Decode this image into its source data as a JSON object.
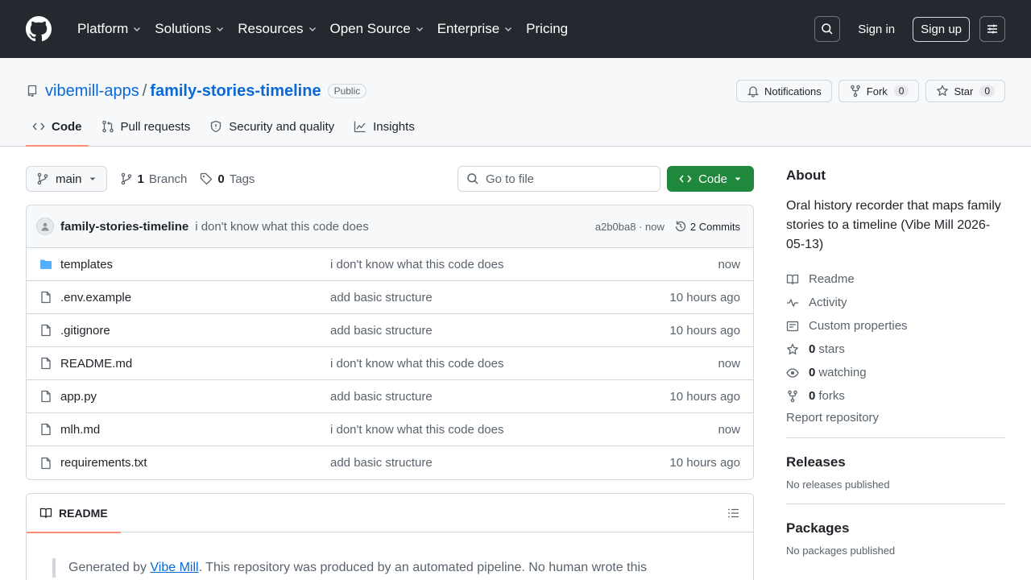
{
  "header": {
    "nav": [
      "Platform",
      "Solutions",
      "Resources",
      "Open Source",
      "Enterprise",
      "Pricing"
    ],
    "sign_in": "Sign in",
    "sign_up": "Sign up"
  },
  "repo": {
    "owner": "vibemill-apps",
    "separator": "/",
    "name": "family-stories-timeline",
    "visibility": "Public",
    "notifications": "Notifications",
    "fork_label": "Fork",
    "fork_count": "0",
    "star_label": "Star",
    "star_count": "0"
  },
  "tabs": [
    {
      "label": "Code",
      "icon": "code-icon"
    },
    {
      "label": "Pull requests",
      "icon": "pull-request-icon"
    },
    {
      "label": "Security and quality",
      "icon": "shield-icon"
    },
    {
      "label": "Insights",
      "icon": "graph-icon"
    }
  ],
  "toolbar": {
    "branch": "main",
    "branch_count": "1",
    "branch_label": "Branch",
    "tag_count": "0",
    "tag_label": "Tags",
    "goto_placeholder": "Go to file",
    "code_button": "Code"
  },
  "commit": {
    "author": "family-stories-timeline",
    "message": "i don't know what this code does",
    "hash_time": "a2b0ba8 · now",
    "commits": "2 Commits"
  },
  "files": [
    {
      "name": "templates",
      "type": "folder",
      "commit": "i don't know what this code does",
      "age": "now"
    },
    {
      "name": ".env.example",
      "type": "file",
      "commit": "add basic structure",
      "age": "10 hours ago"
    },
    {
      "name": ".gitignore",
      "type": "file",
      "commit": "add basic structure",
      "age": "10 hours ago"
    },
    {
      "name": "README.md",
      "type": "file",
      "commit": "i don't know what this code does",
      "age": "now"
    },
    {
      "name": "app.py",
      "type": "file",
      "commit": "add basic structure",
      "age": "10 hours ago"
    },
    {
      "name": "mlh.md",
      "type": "file",
      "commit": "i don't know what this code does",
      "age": "now"
    },
    {
      "name": "requirements.txt",
      "type": "file",
      "commit": "add basic structure",
      "age": "10 hours ago"
    }
  ],
  "readme": {
    "tab": "README",
    "prefix": "Generated by ",
    "link": "Vibe Mill",
    "suffix": ". This repository was produced by an automated pipeline. No human wrote this"
  },
  "about": {
    "title": "About",
    "description": "Oral history recorder that maps family stories to a timeline (Vibe Mill 2026-05-13)",
    "readme": "Readme",
    "activity": "Activity",
    "custom_properties": "Custom properties",
    "stars_count": "0",
    "stars_label": "stars",
    "watching_count": "0",
    "watching_label": "watching",
    "forks_count": "0",
    "forks_label": "forks",
    "report": "Report repository"
  },
  "releases": {
    "title": "Releases",
    "sub": "No releases published"
  },
  "packages": {
    "title": "Packages",
    "sub": "No packages published"
  },
  "colors": {
    "header_bg": "#24292f",
    "link": "#0969da",
    "primary_button": "#1f883d",
    "tab_underline": "#fd8c73"
  }
}
